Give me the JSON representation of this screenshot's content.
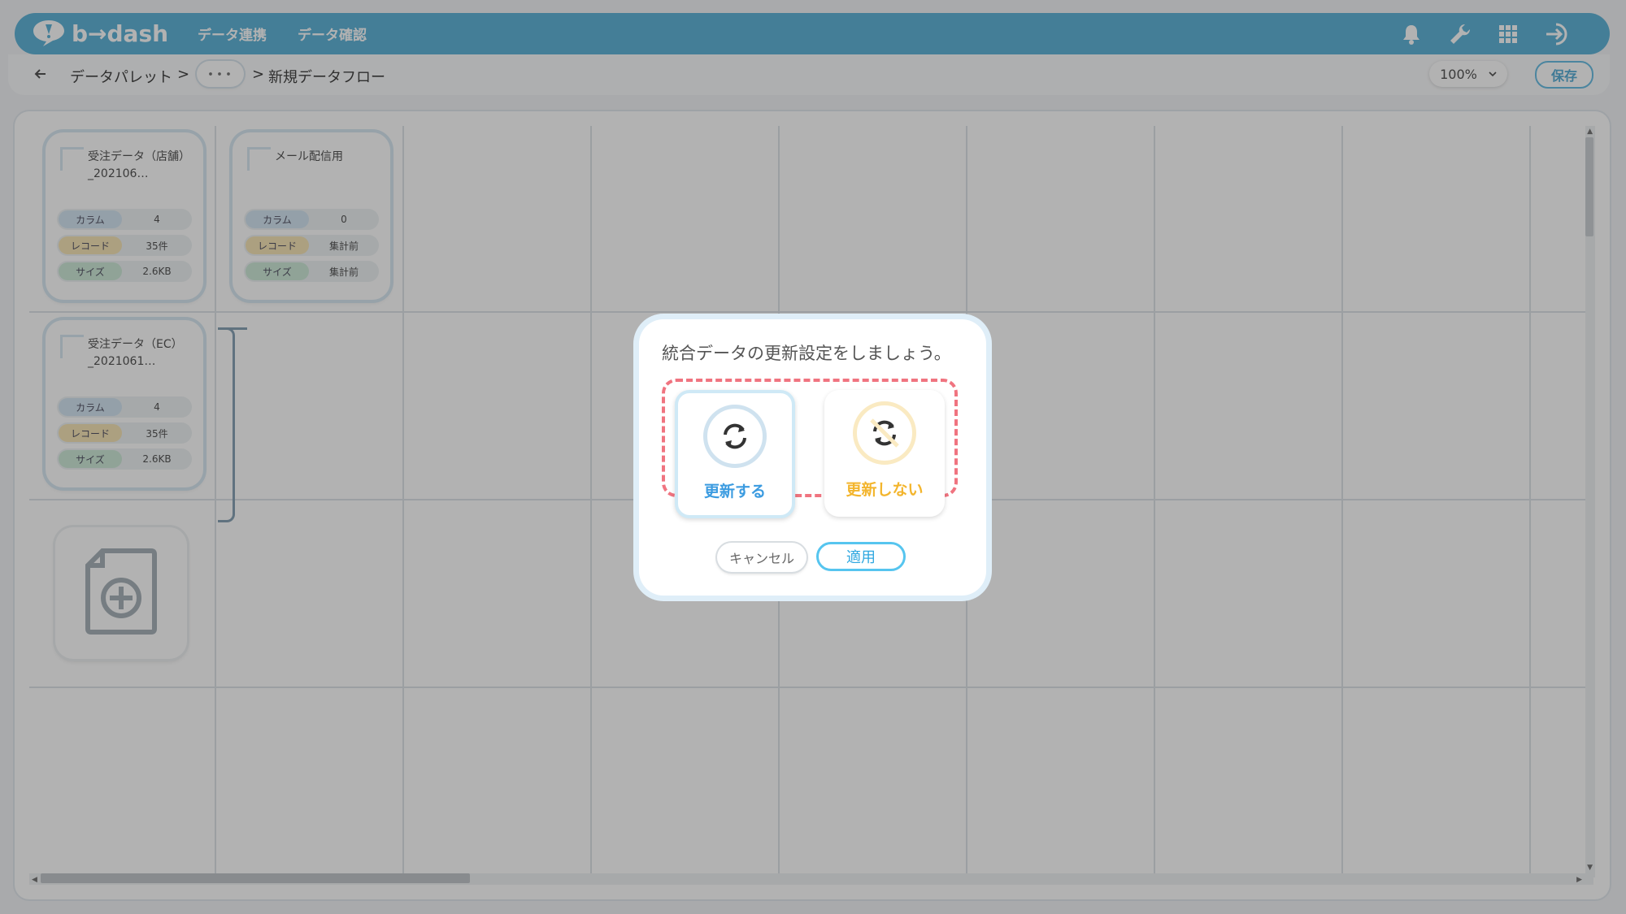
{
  "brand": {
    "logo_text": "b→dash"
  },
  "nav": [
    {
      "label": "データ連携"
    },
    {
      "label": "データ確認"
    }
  ],
  "breadcrumb": {
    "root": "データパレット",
    "separator": ">",
    "more": "･･･",
    "current": "新規データフロー"
  },
  "toolbar": {
    "zoom": "100%",
    "save_label": "保存"
  },
  "cards": [
    {
      "title": "受注データ（店舗）_202106…",
      "rows": [
        {
          "key": "カラム",
          "value": "4"
        },
        {
          "key": "レコード",
          "value": "35件"
        },
        {
          "key": "サイズ",
          "value": "2.6KB"
        }
      ]
    },
    {
      "title": "メール配信用",
      "rows": [
        {
          "key": "カラム",
          "value": "0"
        },
        {
          "key": "レコード",
          "value": "集計前"
        },
        {
          "key": "サイズ",
          "value": "集計前"
        }
      ]
    },
    {
      "title": "受注データ（EC）_2021061…",
      "rows": [
        {
          "key": "カラム",
          "value": "4"
        },
        {
          "key": "レコード",
          "value": "35件"
        },
        {
          "key": "サイズ",
          "value": "2.6KB"
        }
      ]
    }
  ],
  "modal": {
    "title": "統合データの更新設定をしましょう。",
    "option_update": "更新する",
    "option_no_update": "更新しない",
    "cancel_label": "キャンセル",
    "apply_label": "適用"
  },
  "colors": {
    "header": "#62b5d9",
    "accent_blue": "#3b9be0",
    "accent_yellow": "#f3b52d",
    "highlight_dash": "#f07480"
  },
  "icons": [
    "bell-icon",
    "wrench-icon",
    "grid-icon",
    "logout-icon",
    "back-arrow-icon",
    "refresh-icon",
    "no-refresh-icon",
    "add-file-icon"
  ]
}
